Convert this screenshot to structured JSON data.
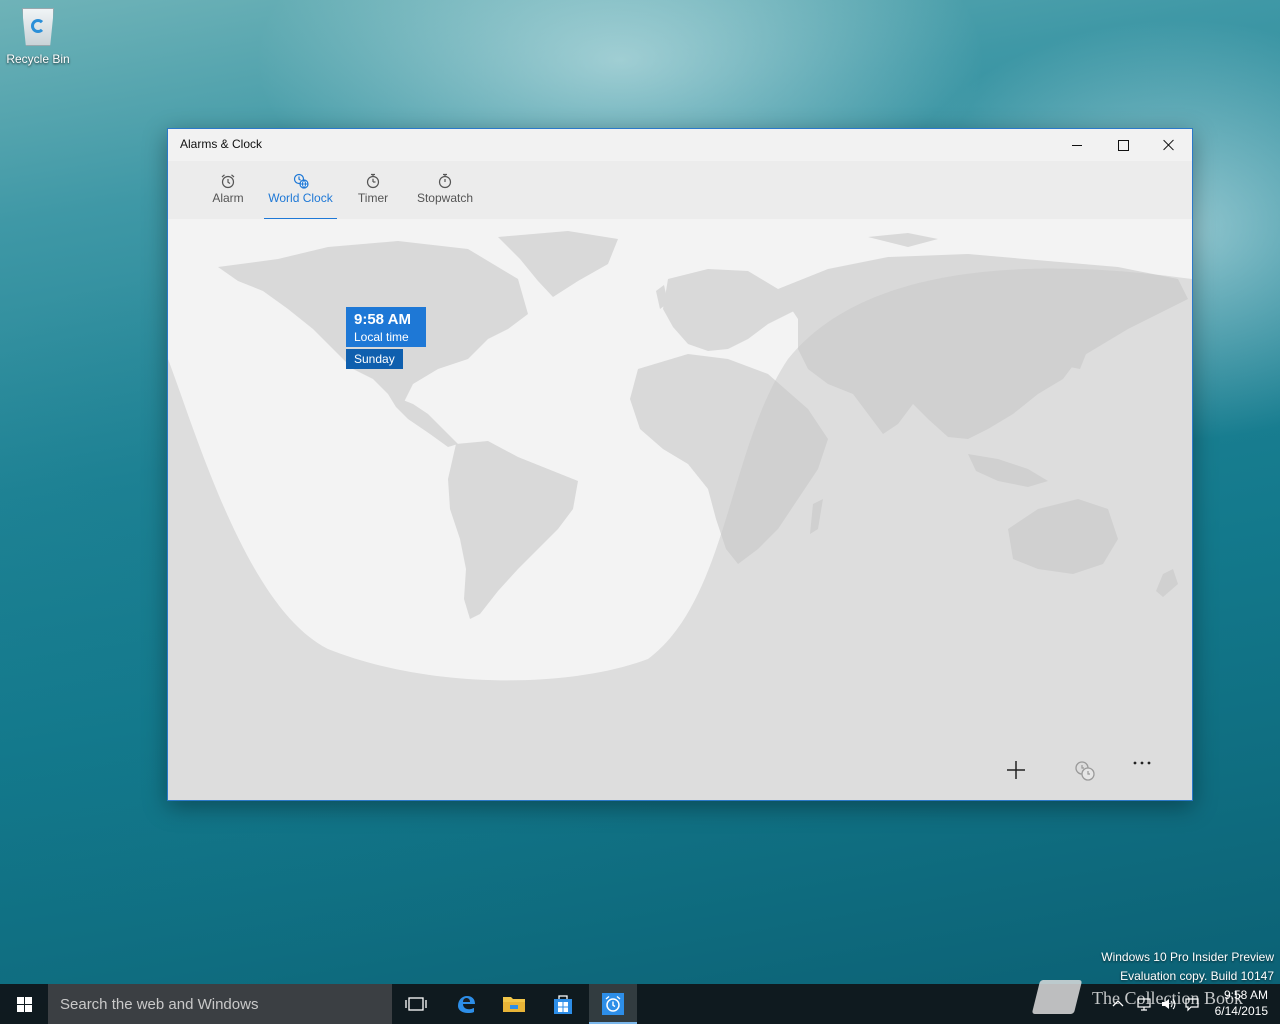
{
  "desktop": {
    "recycle_bin_label": "Recycle Bin"
  },
  "window": {
    "title": "Alarms & Clock",
    "tabs": [
      {
        "label": "Alarm",
        "icon": "alarm-clock-icon",
        "active": false
      },
      {
        "label": "World Clock",
        "icon": "world-clock-icon",
        "active": true
      },
      {
        "label": "Timer",
        "icon": "timer-icon",
        "active": false
      },
      {
        "label": "Stopwatch",
        "icon": "stopwatch-icon",
        "active": false
      }
    ],
    "local_clock": {
      "time": "9:58 AM",
      "label": "Local time",
      "day": "Sunday"
    },
    "commands": [
      {
        "name": "add",
        "icon": "plus-icon"
      },
      {
        "name": "compare",
        "icon": "compare-clocks-icon"
      },
      {
        "name": "more",
        "icon": "more-icon"
      }
    ],
    "accent_color": "#1e78d6"
  },
  "watermark": {
    "line1": "Windows 10 Pro Insider Preview",
    "line2": "Evaluation copy. Build 10147"
  },
  "taskbar": {
    "search_placeholder": "Search the web and Windows",
    "clock_time": "9:58 AM",
    "clock_date": "6/14/2015",
    "pinned": [
      "task-view-icon",
      "edge-icon",
      "file-explorer-icon",
      "store-icon",
      "alarms-app-icon"
    ],
    "brand_overlay": "The Collection Book"
  }
}
